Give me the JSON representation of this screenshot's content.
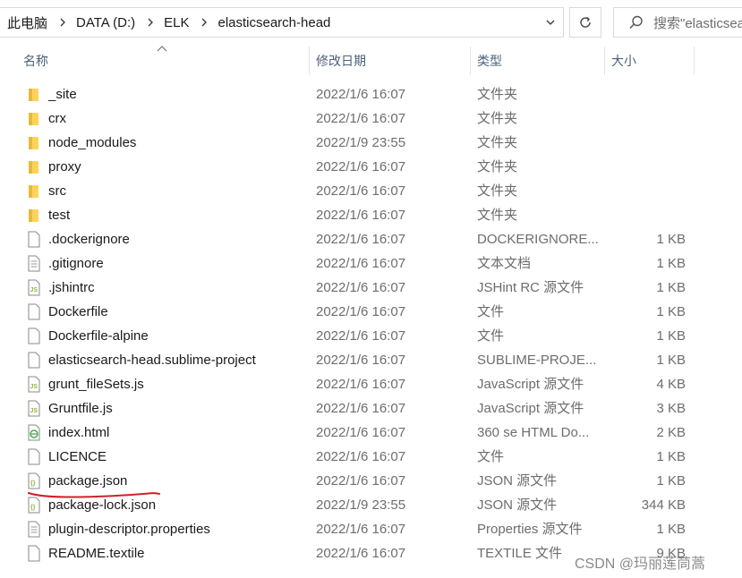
{
  "breadcrumb": {
    "items": [
      "此电脑",
      "DATA (D:)",
      "ELK",
      "elasticsearch-head"
    ]
  },
  "search": {
    "placeholder": "搜索\"elasticsearch-head\""
  },
  "columns": {
    "name": "名称",
    "date": "修改日期",
    "type": "类型",
    "size": "大小"
  },
  "files": [
    {
      "name": "_site",
      "date": "2022/1/6 16:07",
      "type": "文件夹",
      "size": "",
      "icon": "folder-icon"
    },
    {
      "name": "crx",
      "date": "2022/1/6 16:07",
      "type": "文件夹",
      "size": "",
      "icon": "folder-icon"
    },
    {
      "name": "node_modules",
      "date": "2022/1/9 23:55",
      "type": "文件夹",
      "size": "",
      "icon": "folder-icon"
    },
    {
      "name": "proxy",
      "date": "2022/1/6 16:07",
      "type": "文件夹",
      "size": "",
      "icon": "folder-icon"
    },
    {
      "name": "src",
      "date": "2022/1/6 16:07",
      "type": "文件夹",
      "size": "",
      "icon": "folder-icon"
    },
    {
      "name": "test",
      "date": "2022/1/6 16:07",
      "type": "文件夹",
      "size": "",
      "icon": "folder-icon"
    },
    {
      "name": ".dockerignore",
      "date": "2022/1/6 16:07",
      "type": "DOCKERIGNORE...",
      "size": "1 KB",
      "icon": "file-icon"
    },
    {
      "name": ".gitignore",
      "date": "2022/1/6 16:07",
      "type": "文本文档",
      "size": "1 KB",
      "icon": "text-file-icon"
    },
    {
      "name": ".jshintrc",
      "date": "2022/1/6 16:07",
      "type": "JSHint RC 源文件",
      "size": "1 KB",
      "icon": "js-file-icon"
    },
    {
      "name": "Dockerfile",
      "date": "2022/1/6 16:07",
      "type": "文件",
      "size": "1 KB",
      "icon": "file-icon"
    },
    {
      "name": "Dockerfile-alpine",
      "date": "2022/1/6 16:07",
      "type": "文件",
      "size": "1 KB",
      "icon": "file-icon"
    },
    {
      "name": "elasticsearch-head.sublime-project",
      "date": "2022/1/6 16:07",
      "type": "SUBLIME-PROJE...",
      "size": "1 KB",
      "icon": "file-icon"
    },
    {
      "name": "grunt_fileSets.js",
      "date": "2022/1/6 16:07",
      "type": "JavaScript 源文件",
      "size": "4 KB",
      "icon": "js-file-icon"
    },
    {
      "name": "Gruntfile.js",
      "date": "2022/1/6 16:07",
      "type": "JavaScript 源文件",
      "size": "3 KB",
      "icon": "js-file-icon"
    },
    {
      "name": "index.html",
      "date": "2022/1/6 16:07",
      "type": "360 se HTML Do...",
      "size": "2 KB",
      "icon": "html-file-icon"
    },
    {
      "name": "LICENCE",
      "date": "2022/1/6 16:07",
      "type": "文件",
      "size": "1 KB",
      "icon": "file-icon"
    },
    {
      "name": "package.json",
      "date": "2022/1/6 16:07",
      "type": "JSON 源文件",
      "size": "1 KB",
      "icon": "json-file-icon"
    },
    {
      "name": "package-lock.json",
      "date": "2022/1/9 23:55",
      "type": "JSON 源文件",
      "size": "344 KB",
      "icon": "json-file-icon"
    },
    {
      "name": "plugin-descriptor.properties",
      "date": "2022/1/6 16:07",
      "type": "Properties 源文件",
      "size": "1 KB",
      "icon": "text-file-icon"
    },
    {
      "name": "README.textile",
      "date": "2022/1/6 16:07",
      "type": "TEXTILE 文件",
      "size": "9 KB",
      "icon": "file-icon"
    }
  ],
  "watermark": "CSDN @玛丽莲茼蒿",
  "colors": {
    "folder": "#ffd35b",
    "json_accent": "#8fb33b",
    "js_accent": "#8fb33b",
    "underline": "#d0202a",
    "header_text": "#4c607a"
  }
}
